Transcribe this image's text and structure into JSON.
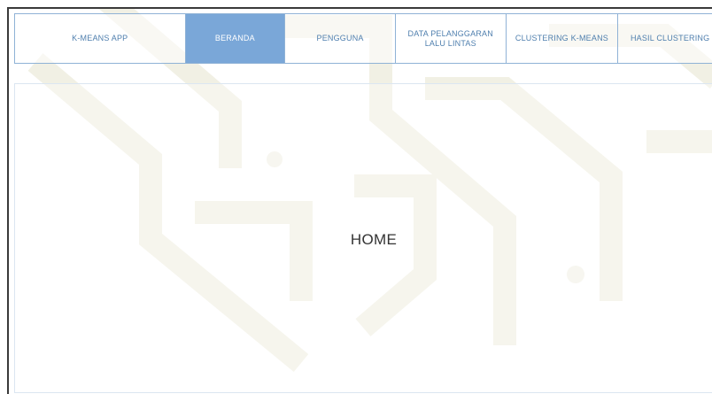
{
  "navbar": {
    "brand": "K-MEANS APP",
    "items": [
      {
        "label": "BERANDA",
        "active": true
      },
      {
        "label": "PENGGUNA",
        "active": false
      },
      {
        "label": "DATA PELANGGARAN LALU LINTAS",
        "active": false
      },
      {
        "label": "CLUSTERING K-MEANS",
        "active": false
      },
      {
        "label": "HASIL CLUSTERING",
        "active": false
      }
    ]
  },
  "main": {
    "heading": "HOME"
  },
  "colors": {
    "accent": "#7aa7d8",
    "nav_text": "#4f7fae",
    "border": "#8fb2d6"
  }
}
